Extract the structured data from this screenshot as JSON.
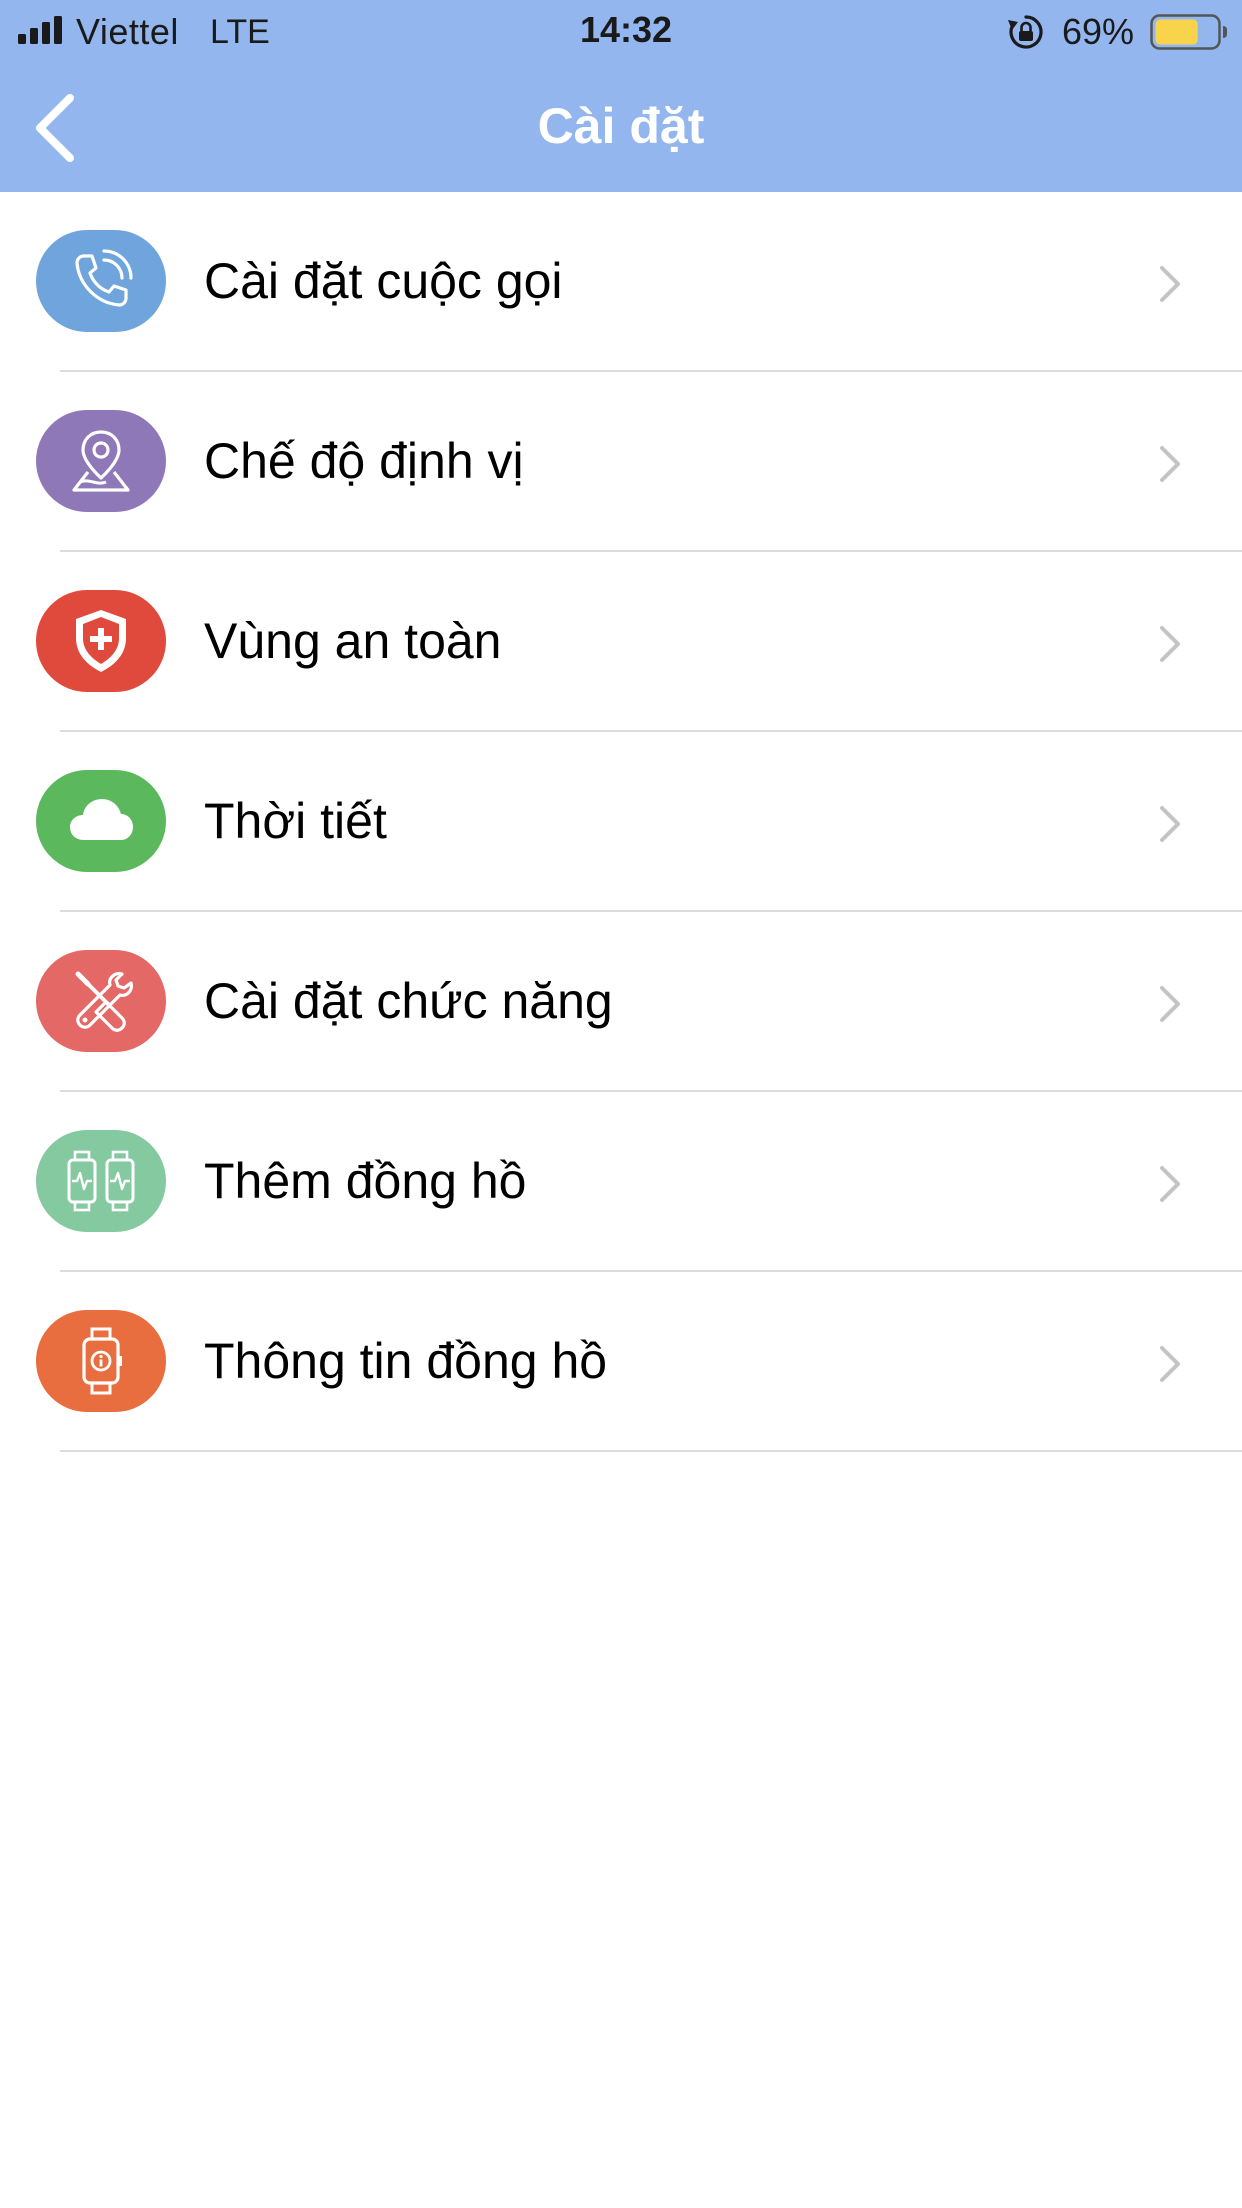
{
  "status_bar": {
    "carrier": "Viettel",
    "network": "LTE",
    "time": "14:32",
    "battery_percent": "69%",
    "battery_level": 0.69,
    "icons": [
      "signal-icon",
      "rotation-lock-icon",
      "battery-icon"
    ]
  },
  "nav": {
    "title": "Cài đặt",
    "back_icon": "chevron-left-icon"
  },
  "menu": {
    "items": [
      {
        "label": "Cài đặt cuộc gọi",
        "icon": "phone-icon",
        "color": "#70a4dc"
      },
      {
        "label": "Chế độ định vị",
        "icon": "location-pin-icon",
        "color": "#8f78b8"
      },
      {
        "label": "Vùng an toàn",
        "icon": "shield-icon",
        "color": "#e04a3c"
      },
      {
        "label": "Thời tiết",
        "icon": "cloud-icon",
        "color": "#5cb85c"
      },
      {
        "label": "Cài đặt chức năng",
        "icon": "tools-icon",
        "color": "#e46866"
      },
      {
        "label": "Thêm đồng hồ",
        "icon": "add-watch-icon",
        "color": "#84c9a0"
      },
      {
        "label": "Thông tin đồng hồ",
        "icon": "watch-info-icon",
        "color": "#e86d3f"
      }
    ],
    "chevron_icon": "chevron-right-icon"
  },
  "colors": {
    "header_bg": "#94b6ee",
    "divider": "#dcdcdc",
    "chevron": "#c4c4c4",
    "battery_fill": "#f7d44c"
  }
}
